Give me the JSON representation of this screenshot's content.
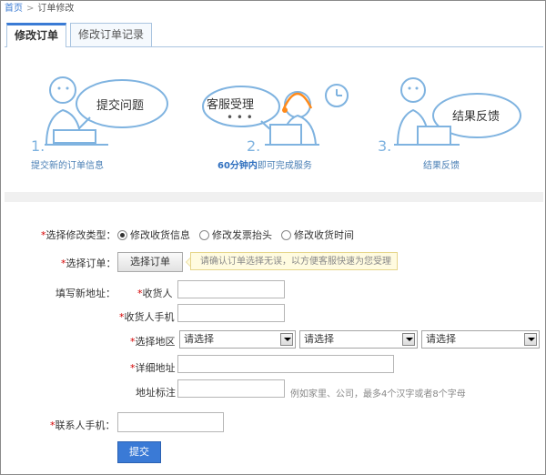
{
  "breadcrumb": {
    "home": "首页",
    "separator": ">",
    "current": "订单修改"
  },
  "tabs": [
    {
      "label": "修改订单"
    },
    {
      "label": "修改订单记录"
    }
  ],
  "steps": [
    {
      "num": "1.",
      "bubble": "提交问题",
      "caption": "提交新的订单信息"
    },
    {
      "num": "2.",
      "bubble": "客服受理",
      "caption_bold": "60分钟内",
      "caption_rest": "即可完成服务"
    },
    {
      "num": "3.",
      "bubble": "结果反馈",
      "caption": "结果反馈"
    }
  ],
  "form": {
    "modify_type_label": "*选择修改类型：",
    "options": [
      "修改收货信息",
      "修改发票抬头",
      "修改收货时间"
    ],
    "selected_option_index": 0,
    "select_order_label": "*选择订单：",
    "select_order_button": "选择订单",
    "select_order_tip": "请确认订单选择无误，以方便客服快速为您受理",
    "new_address_label": "填写新地址：",
    "receiver_label": "*收货人",
    "receiver_value": "",
    "receiver_phone_label": "*收货人手机",
    "receiver_phone_value": "",
    "region_label": "*选择地区",
    "region_selects": [
      "请选择",
      "请选择",
      "请选择"
    ],
    "detail_address_label": "*详细地址",
    "detail_address_value": "",
    "address_tag_label": "地址标注",
    "address_tag_value": "",
    "address_tag_hint": "例如家里、公司，最多4个汉字或者8个字母",
    "contact_phone_label": "*联系人手机：",
    "contact_phone_value": "",
    "submit_label": "提交"
  },
  "colors": {
    "accent": "#3a7ad6",
    "required": "#d40000",
    "tip_bg": "#fffbe0",
    "illustration": "#7fb3e0"
  }
}
